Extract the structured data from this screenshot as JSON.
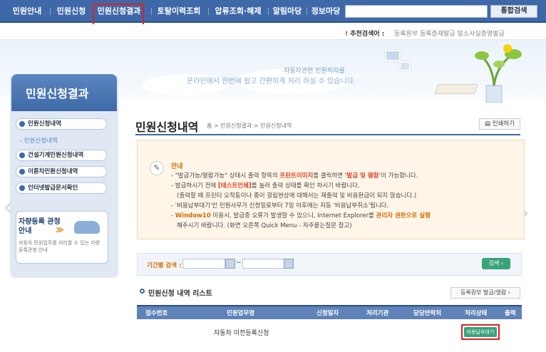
{
  "topnav": {
    "items": [
      "민원안내",
      "민원신청",
      "민원신청결과",
      "토탈이력조회",
      "압류조회·해제",
      "알림마당",
      "정보마당"
    ],
    "search_button": "통합검색",
    "search_value": ""
  },
  "subbar": {
    "recommend_label": "추천검색어 :",
    "recommend_links": "등록원부  등록증재발급  말소사실증명발급"
  },
  "banner": {
    "line1": "자동차관련 민원처리를",
    "line2": "온라인에서 한번에 쉽고 간편하게 처리 하실 수 있습니다."
  },
  "sidebar": {
    "title": "민원신청결과",
    "items": [
      "민원신청내역",
      "건설기계민원신청내역",
      "이륜차민원신청내역",
      "인터넷발급문서확인"
    ],
    "sub_item": "민원신청내역",
    "promo_title": "자량등록 관청 안내",
    "promo_arrow": "≫",
    "promo_text": "자동차 민원업무를 처리할 수 있는 자량등록관청 안내"
  },
  "main": {
    "title": "민원신청내역",
    "breadcrumb": "홈 > 민원신청결과 > 민원신청내역",
    "print_label": "인쇄하기"
  },
  "notice": {
    "heading": "안내",
    "l1a": "- \"발급가능/열람가능\" 상태시 출력 항목의 ",
    "l1b": "프린트이미지",
    "l1c": "를 클릭하면 ",
    "l1d": "'발급 및 열람'",
    "l1e": "이 가능합니다.",
    "l2a": "- 발급하시기 전에 ",
    "l2b": "[테스트인쇄]",
    "l2c": "를 눌러 출력 상태를 확인 하시기 바랍니다.",
    "l3": "(출력할 때 프린터 오작동이나 종이 걸림현상에 대해서는 재출력 및 비용환급이 되지 않습니다.)",
    "l4": "- '비용납부대기'인 민원사무가 신청일로부터 7일 이후에는 자동 '비용납부취소'됩니다.",
    "l5a": "- ",
    "l5b": "Window10",
    "l5c": " 이용시, 발급중 오류가 발생할 수 있으니, Internet Explorer를 ",
    "l5d": "관리자 권한으로 실행",
    "l6": "해주시기 바랍니다. (화면 오른쪽 Quick Menu - 자주묻는질문 참고)"
  },
  "search_panel": {
    "period_label": "기간별 검색 :",
    "tilde": "~",
    "from": "",
    "to": "",
    "button": "검색 ›"
  },
  "list": {
    "title": "민원신청 내역 리스트",
    "button": "등록원부 발급/열람 ›",
    "headers": [
      "접수번호",
      "민원업무명",
      "신청일자",
      "처리기관",
      "담당연락처",
      "처리상태",
      "출력"
    ],
    "rows": [
      {
        "number": "",
        "task": "자동차 이전등록신청",
        "date": "",
        "agency": "",
        "contact": "",
        "status": "비용납부대기",
        "output": ""
      }
    ]
  },
  "colors": {
    "nav": "#3e68a8",
    "accent": "#d86a00",
    "highlight": "#e02020",
    "green": "#3aa37e"
  }
}
